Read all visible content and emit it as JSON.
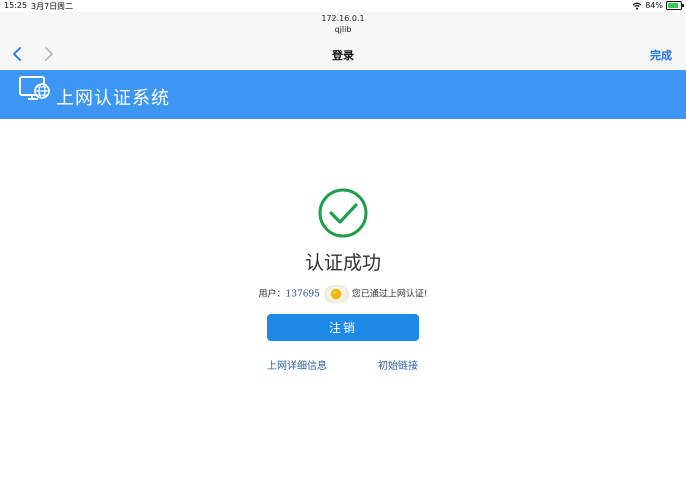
{
  "status_bar": {
    "time": "15:25",
    "date": "3月7日周二",
    "battery_percent_text": "84%",
    "battery_level": 0.84
  },
  "nav": {
    "ip": "172.16.0.1",
    "host": "qjlib",
    "title": "登录",
    "done_label": "完成"
  },
  "header": {
    "title": "上网认证系统",
    "color": "#3d97f2"
  },
  "result": {
    "title": "认证成功",
    "user_label": "用户：",
    "user_id": "137695",
    "message": "您已通过上网认证!",
    "logout_label": "注销",
    "detail_link": "上网详细信息",
    "reset_link": "初始链接",
    "accent": "#1c8ae6",
    "success_color": "#1e9e4a"
  }
}
